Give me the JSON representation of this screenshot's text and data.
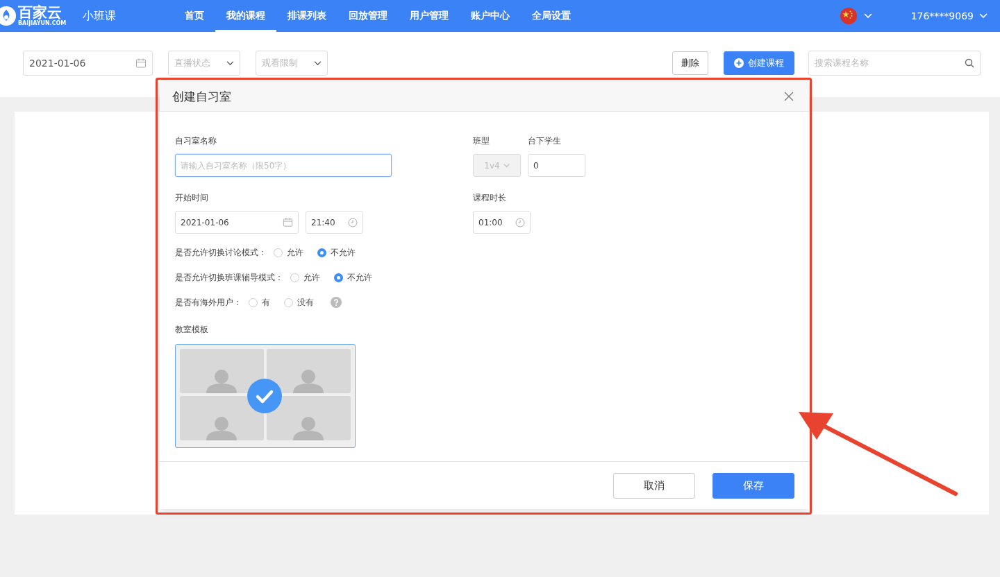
{
  "header": {
    "logo": {
      "name": "百家云",
      "domain": "BAIJIAYUN.COM"
    },
    "product": "小班课",
    "nav": [
      {
        "label": "首页",
        "selected": false
      },
      {
        "label": "我的课程",
        "selected": true
      },
      {
        "label": "排课列表",
        "selected": false
      },
      {
        "label": "回放管理",
        "selected": false
      },
      {
        "label": "用户管理",
        "selected": false
      },
      {
        "label": "账户中心",
        "selected": false
      },
      {
        "label": "全局设置",
        "selected": false
      }
    ],
    "account": "176****9069"
  },
  "toolbar": {
    "date": "2021-01-06",
    "filters": [
      {
        "placeholder": "直播状态"
      },
      {
        "placeholder": "观看限制"
      }
    ],
    "buttons": [
      {
        "label": "删除",
        "kind": "default"
      },
      {
        "label": "创建课程",
        "kind": "primary"
      }
    ],
    "search": {
      "placeholder": "搜索课程名称"
    }
  },
  "dialog": {
    "title": "创建自习室",
    "name_field": {
      "label": "自习室名称",
      "placeholder": "请输入自习室名称（限50字）"
    },
    "class_type": {
      "label": "班型",
      "value": "1v4",
      "disabled": true
    },
    "audience": {
      "label": "台下学生",
      "value": "0"
    },
    "start": {
      "label": "开始时间",
      "date": "2021-01-06",
      "time": "21:40"
    },
    "duration": {
      "label": "课程时长",
      "value": "01:00"
    },
    "options": [
      {
        "label": "是否允许切换讨论模式：",
        "help": false,
        "choices": [
          {
            "label": "允许",
            "selected": false
          },
          {
            "label": "不允许",
            "selected": true
          }
        ]
      },
      {
        "label": "是否允许切换班课辅导模式：",
        "help": false,
        "choices": [
          {
            "label": "允许",
            "selected": false
          },
          {
            "label": "不允许",
            "selected": true
          }
        ]
      },
      {
        "label": "是否有海外用户：",
        "help": true,
        "choices": [
          {
            "label": "有",
            "selected": false
          },
          {
            "label": "没有",
            "selected": false
          }
        ]
      }
    ],
    "template": {
      "label": "教室模板",
      "items": [
        {
          "selected": true
        }
      ]
    },
    "buttons": [
      {
        "label": "取消",
        "kind": "default"
      },
      {
        "label": "保存",
        "kind": "primary"
      }
    ]
  }
}
